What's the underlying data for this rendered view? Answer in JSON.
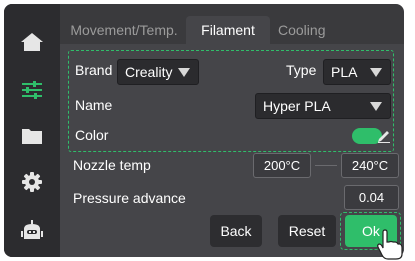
{
  "tabs": [
    {
      "label": "Movement/Temp."
    },
    {
      "label": "Filament"
    },
    {
      "label": "Cooling"
    }
  ],
  "active_tab": "Filament",
  "filament": {
    "brand_label": "Brand",
    "brand_value": "Creality",
    "type_label": "Type",
    "type_value": "PLA",
    "name_label": "Name",
    "name_value": "Hyper PLA",
    "color_label": "Color",
    "color_value": "#2fbe6a"
  },
  "nozzle": {
    "label": "Nozzle temp",
    "min": "200°C",
    "max": "240°C"
  },
  "pressure": {
    "label": "Pressure advance",
    "value": "0.04"
  },
  "buttons": {
    "back": "Back",
    "reset": "Reset",
    "ok": "Ok"
  },
  "sidebar": {
    "items": [
      {
        "icon": "home-icon"
      },
      {
        "icon": "sliders-icon",
        "active": true
      },
      {
        "icon": "folder-icon"
      },
      {
        "icon": "gear-icon"
      },
      {
        "icon": "robot-icon"
      }
    ]
  },
  "colors": {
    "accent": "#2fbe6a",
    "background": "#3a3a3d",
    "panel": "#454549"
  }
}
